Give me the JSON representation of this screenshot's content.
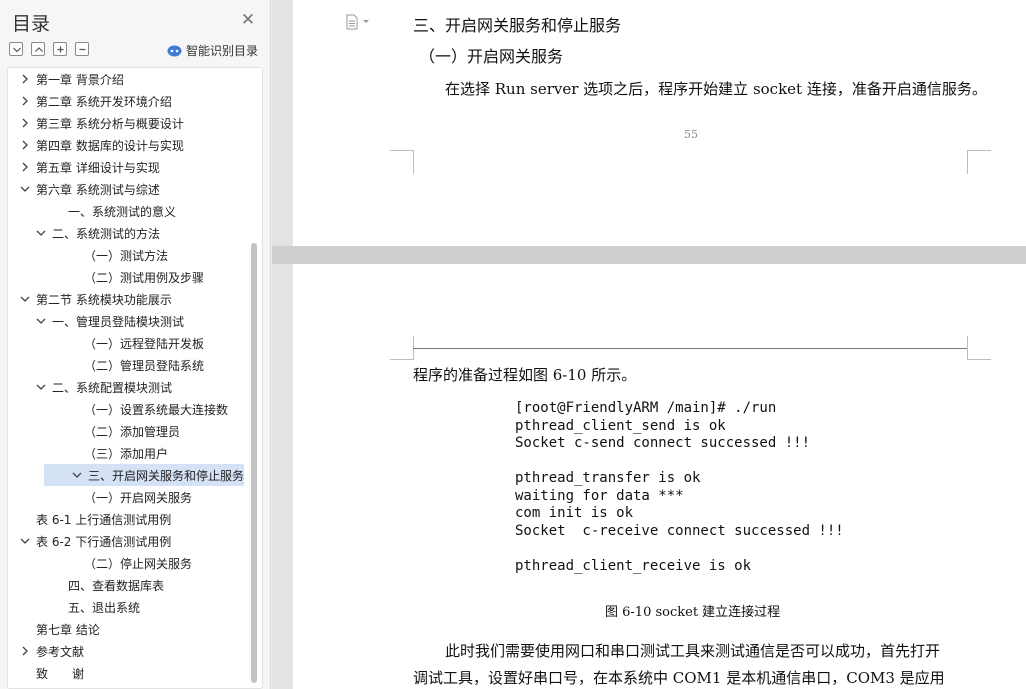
{
  "sidebar": {
    "title": "目录",
    "smart_label": "智能识别目录",
    "items": [
      {
        "label": "第一章  背景介绍",
        "level": 0,
        "chevron": "right"
      },
      {
        "label": "第二章  系统开发环境介绍",
        "level": 0,
        "chevron": "right"
      },
      {
        "label": "第三章  系统分析与概要设计",
        "level": 0,
        "chevron": "right"
      },
      {
        "label": "第四章  数据库的设计与实现",
        "level": 0,
        "chevron": "right"
      },
      {
        "label": "第五章  详细设计与实现",
        "level": 0,
        "chevron": "right"
      },
      {
        "label": "第六章  系统测试与综述",
        "level": 0,
        "chevron": "down"
      },
      {
        "label": "一、系统测试的意义",
        "level": 2,
        "chevron": "none"
      },
      {
        "label": "二、系统测试的方法",
        "level": 1,
        "chevron": "down"
      },
      {
        "label": "（一）测试方法",
        "level": 3,
        "chevron": "none"
      },
      {
        "label": "（二）测试用例及步骤",
        "level": 3,
        "chevron": "none"
      },
      {
        "label": "第二节  系统模块功能展示",
        "level": 1,
        "chevron": "down",
        "offset": -16
      },
      {
        "label": "一、管理员登陆模块测试",
        "level": 1,
        "chevron": "down"
      },
      {
        "label": "（一）远程登陆开发板",
        "level": 3,
        "chevron": "none"
      },
      {
        "label": "（二）管理员登陆系统",
        "level": 3,
        "chevron": "none"
      },
      {
        "label": "二、系统配置模块测试",
        "level": 1,
        "chevron": "down"
      },
      {
        "label": "（一）设置系统最大连接数",
        "level": 3,
        "chevron": "none"
      },
      {
        "label": "（二）添加管理员",
        "level": 3,
        "chevron": "none"
      },
      {
        "label": "（三）添加用户",
        "level": 3,
        "chevron": "none"
      },
      {
        "label": "三、开启网关服务和停止服务",
        "level": 1,
        "chevron": "down",
        "active": true
      },
      {
        "label": "（一）开启网关服务",
        "level": 3,
        "chevron": "none"
      },
      {
        "label": "表 6-1  上行通信测试用例",
        "level": 1,
        "chevron": "none",
        "offset": -16
      },
      {
        "label": "表 6-2  下行通信测试用例",
        "level": 1,
        "chevron": "down",
        "offset": -16
      },
      {
        "label": "（二）停止网关服务",
        "level": 3,
        "chevron": "none"
      },
      {
        "label": "四、查看数据库表",
        "level": 2,
        "chevron": "none"
      },
      {
        "label": "五、退出系统",
        "level": 2,
        "chevron": "none"
      },
      {
        "label": "第七章  结论",
        "level": 0,
        "chevron": "none"
      },
      {
        "label": "参考文献",
        "level": 0,
        "chevron": "right"
      },
      {
        "label": "致　　谢",
        "level": 0,
        "chevron": "none"
      }
    ]
  },
  "doc": {
    "page1": {
      "heading3": "三、开启网关服务和停止服务",
      "heading4": "（一）开启网关服务",
      "para1": "在选择 Run server 选项之后，程序开始建立 socket 连接，准备开启通信服务。",
      "page_number": "55"
    },
    "page2": {
      "intro": "程序的准备过程如图 6-10 所示。",
      "code_lines": [
        "[root@FriendlyARM /main]# ./run",
        "pthread_client_send is ok",
        "Socket c-send connect successed !!!",
        "",
        "pthread_transfer is ok",
        "waiting for data ***",
        "com init is ok",
        "Socket  c-receive connect successed !!!",
        "",
        "pthread_client_receive is ok"
      ],
      "caption": "图 6-10 socket 建立连接过程",
      "para2_line1": "此时我们需要使用网口和串口测试工具来测试通信是否可以成功，首先打开",
      "para2_line2": "调试工具，设置好串口号，在本系统中 COM1 是本机通信串口，COM3 是应用"
    }
  },
  "colors": {
    "active_row": "#d5e1f5",
    "smart_icon": "#3d7bd9"
  },
  "icons": {
    "close": "close-icon",
    "collapse_all": "collapse-all-icon",
    "expand_up": "expand-up-icon",
    "add": "plus-icon",
    "remove": "minus-icon",
    "smart": "smart-toc-icon",
    "doc": "document-icon"
  }
}
